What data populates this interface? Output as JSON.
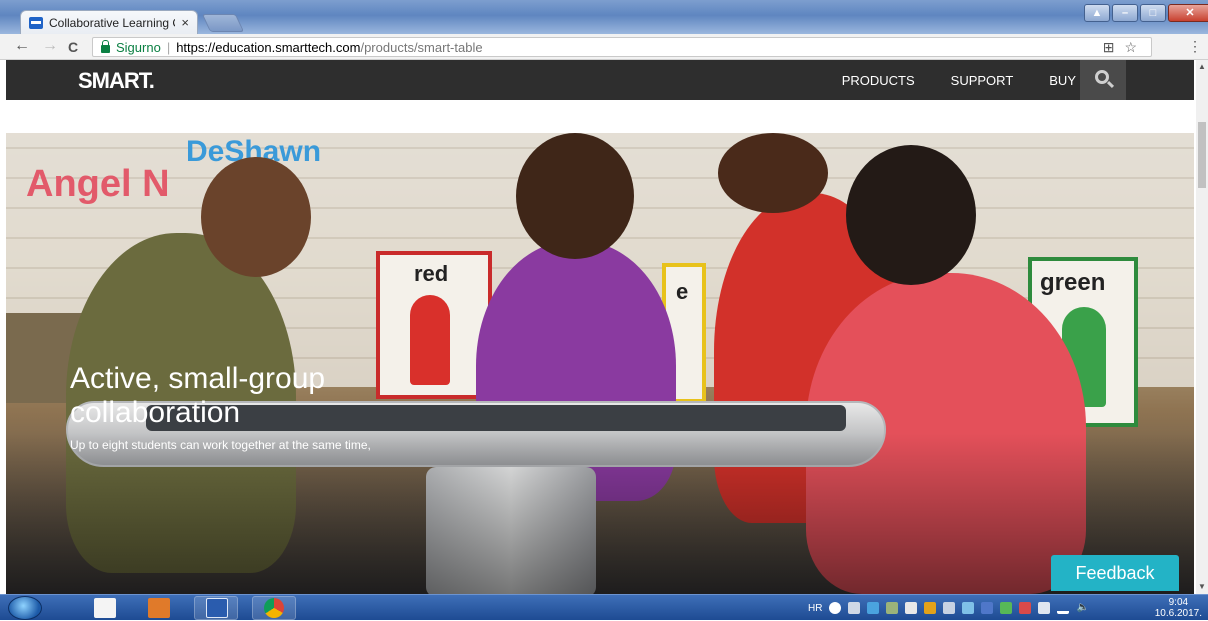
{
  "browser": {
    "tab_title": "Collaborative Learning C",
    "tab_close": "×",
    "address": {
      "security_label": "Sigurno",
      "url_host": "https://education.smarttech.com",
      "url_path": "/products/smart-table"
    },
    "nav": {
      "back": "←",
      "forward": "→",
      "reload": "C"
    }
  },
  "site": {
    "logo": "SMART.",
    "nav_items": [
      "PRODUCTS",
      "SUPPORT",
      "BUY"
    ]
  },
  "hero": {
    "title": "Active, small-group collaboration",
    "subtitle": "Up to eight students can work together at the same time,",
    "poster_labels": [
      "Angel N",
      "DeShawn",
      "red",
      "green",
      "e"
    ]
  },
  "feedback": {
    "label": "Feedback"
  },
  "taskbar": {
    "language": "HR",
    "time": "9:04",
    "date": "10.6.2017."
  }
}
